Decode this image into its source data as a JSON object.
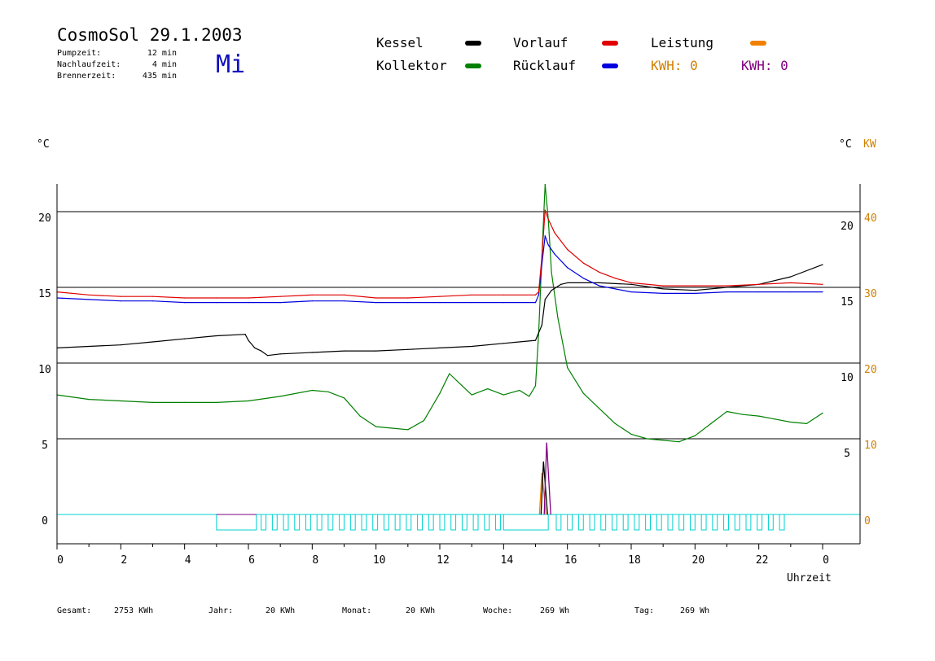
{
  "header": {
    "title": "CosmoSol 29.1.2003",
    "day": "Mi",
    "stats": [
      {
        "label": "Pumpzeit:",
        "value": "12 min"
      },
      {
        "label": "Nachlaufzeit:",
        "value": "4 min"
      },
      {
        "label": "Brennerzeit:",
        "value": "435 min"
      }
    ]
  },
  "legend": [
    {
      "label": "Kessel",
      "color": "#000000"
    },
    {
      "label": "Vorlauf",
      "color": "#e00000"
    },
    {
      "label": "Leistung",
      "color": "#f08000"
    },
    {
      "label": "Kollektor",
      "color": "#008000"
    },
    {
      "label": "Rücklauf",
      "color": "#0000e0"
    }
  ],
  "kwh": [
    {
      "text": "KWH: 0",
      "color": "#d08000"
    },
    {
      "text": "KWH: 0",
      "color": "#800080"
    }
  ],
  "axis_units": {
    "left": "°C",
    "right": "°C",
    "right_kw": "KW"
  },
  "footer": [
    {
      "label": "Gesamt:",
      "value": "2753 KWh"
    },
    {
      "label": "Jahr:",
      "value": "20 KWh"
    },
    {
      "label": "Monat:",
      "value": "20 KWh"
    },
    {
      "label": "Woche:",
      "value": "269 Wh"
    },
    {
      "label": "Tag:",
      "value": "269 Wh"
    }
  ],
  "colors": {
    "kessel": "#000000",
    "vorlauf": "#e00000",
    "ruecklauf": "#0000e0",
    "kollektor": "#008000",
    "leistung": "#f08000",
    "pump": "#00d0d0",
    "kw_axis": "#d08000",
    "purple": "#800080"
  },
  "chart_data": {
    "type": "line",
    "xlabel": "Uhrzeit",
    "xlim": [
      0,
      24
    ],
    "ylim": [
      -3,
      22
    ],
    "x_ticks": [
      0,
      2,
      4,
      6,
      8,
      10,
      12,
      14,
      16,
      18,
      20,
      22,
      24
    ],
    "x_tick_labels": [
      "0",
      "2",
      "4",
      "6",
      "8",
      "10",
      "12",
      "14",
      "16",
      "18",
      "20",
      "22",
      "0"
    ],
    "y_ticks_left": [
      0,
      5,
      10,
      15,
      20
    ],
    "y_ticks_right": [
      5,
      10,
      15,
      20
    ],
    "y_ticks_kw": [
      0,
      10,
      20,
      30,
      40
    ],
    "hlines": [
      0,
      5,
      10,
      15,
      20
    ],
    "series": [
      {
        "name": "Vorlauf",
        "color": "#e00000",
        "x": [
          0,
          1,
          2,
          3,
          4,
          5,
          6,
          7,
          8,
          9,
          10,
          11,
          12,
          13,
          14,
          15,
          15.1,
          15.2,
          15.3,
          15.4,
          15.6,
          16,
          16.5,
          17,
          17.5,
          18,
          19,
          20,
          21,
          22,
          23,
          24
        ],
        "y": [
          14.7,
          14.5,
          14.4,
          14.4,
          14.3,
          14.3,
          14.3,
          14.4,
          14.5,
          14.5,
          14.3,
          14.3,
          14.4,
          14.5,
          14.5,
          14.5,
          14.7,
          17,
          20.1,
          19.5,
          18.6,
          17.5,
          16.6,
          16,
          15.6,
          15.3,
          15.1,
          15.1,
          15.1,
          15.2,
          15.3,
          15.2
        ]
      },
      {
        "name": "Rücklauf",
        "color": "#0000e0",
        "x": [
          0,
          1,
          2,
          3,
          4,
          5,
          6,
          7,
          8,
          9,
          10,
          11,
          12,
          13,
          14,
          15,
          15.1,
          15.2,
          15.3,
          15.4,
          15.6,
          16,
          16.5,
          17,
          17.5,
          18,
          19,
          20,
          21,
          22,
          23,
          24
        ],
        "y": [
          14.3,
          14.2,
          14.1,
          14.1,
          14.0,
          14.0,
          14.0,
          14.0,
          14.1,
          14.1,
          14.0,
          14.0,
          14.0,
          14.0,
          14.0,
          14.0,
          14.5,
          16.5,
          18.4,
          17.8,
          17.2,
          16.3,
          15.6,
          15.1,
          14.9,
          14.7,
          14.6,
          14.6,
          14.7,
          14.7,
          14.7,
          14.7
        ]
      },
      {
        "name": "Kessel",
        "color": "#000000",
        "x": [
          0,
          1,
          2,
          3,
          4,
          5,
          5.9,
          6.0,
          6.2,
          6.4,
          6.6,
          7,
          8,
          9,
          10,
          11,
          12,
          13,
          14,
          15,
          15.2,
          15.3,
          15.5,
          15.8,
          16,
          17,
          18,
          19,
          20,
          21,
          22,
          23,
          24
        ],
        "y": [
          11.0,
          11.1,
          11.2,
          11.4,
          11.6,
          11.8,
          11.9,
          11.5,
          11.0,
          10.8,
          10.5,
          10.6,
          10.7,
          10.8,
          10.8,
          10.9,
          11.0,
          11.1,
          11.3,
          11.5,
          12.5,
          14.2,
          14.8,
          15.2,
          15.3,
          15.3,
          15.2,
          14.9,
          14.8,
          15.0,
          15.2,
          15.7,
          16.5
        ]
      },
      {
        "name": "Kollektor",
        "color": "#008000",
        "x": [
          0,
          1,
          2,
          3,
          4,
          5,
          6,
          7,
          8,
          8.5,
          9,
          9.5,
          10,
          10.5,
          11,
          11.5,
          12,
          12.3,
          12.7,
          13,
          13.5,
          14,
          14.5,
          14.8,
          15,
          15.1,
          15.2,
          15.3,
          15.4,
          15.5,
          15.7,
          16,
          16.5,
          17,
          17.5,
          18,
          18.5,
          19,
          19.5,
          20,
          20.5,
          21,
          21.5,
          22,
          22.5,
          23,
          23.5,
          24
        ],
        "y": [
          7.9,
          7.6,
          7.5,
          7.4,
          7.4,
          7.4,
          7.5,
          7.8,
          8.2,
          8.1,
          7.7,
          6.5,
          5.8,
          5.7,
          5.6,
          6.2,
          8.0,
          9.3,
          8.5,
          7.9,
          8.3,
          7.9,
          8.2,
          7.8,
          8.5,
          12,
          17,
          21.8,
          19.5,
          16,
          13,
          9.7,
          8.0,
          7.0,
          6.0,
          5.3,
          5.0,
          4.9,
          4.8,
          5.2,
          6.0,
          6.8,
          6.6,
          6.5,
          6.3,
          6.1,
          6.0,
          6.7
        ]
      }
    ],
    "leistung_spikes": [
      {
        "x": 15.2,
        "kw": 5.5,
        "color": "#f08000"
      },
      {
        "x": 15.25,
        "kw": 7.0,
        "color": "#000000"
      },
      {
        "x": 15.35,
        "kw": 9.5,
        "color": "#800080"
      }
    ],
    "pump_blocks": [
      [
        5.0,
        6.25
      ],
      [
        6.4,
        6.55
      ],
      [
        6.75,
        6.9
      ],
      [
        7.1,
        7.25
      ],
      [
        7.45,
        7.6
      ],
      [
        7.8,
        7.95
      ],
      [
        8.15,
        8.3
      ],
      [
        8.5,
        8.65
      ],
      [
        8.85,
        9.0
      ],
      [
        9.2,
        9.35
      ],
      [
        9.55,
        9.7
      ],
      [
        9.9,
        10.05
      ],
      [
        10.25,
        10.4
      ],
      [
        10.6,
        10.75
      ],
      [
        10.95,
        11.1
      ],
      [
        11.3,
        11.45
      ],
      [
        11.65,
        11.8
      ],
      [
        12.0,
        12.15
      ],
      [
        12.35,
        12.5
      ],
      [
        12.7,
        12.85
      ],
      [
        13.05,
        13.2
      ],
      [
        13.4,
        13.55
      ],
      [
        13.75,
        13.9
      ],
      [
        14.0,
        15.4
      ],
      [
        15.65,
        15.8
      ],
      [
        16.0,
        16.15
      ],
      [
        16.35,
        16.5
      ],
      [
        16.7,
        16.85
      ],
      [
        17.05,
        17.2
      ],
      [
        17.4,
        17.55
      ],
      [
        17.75,
        17.9
      ],
      [
        18.1,
        18.25
      ],
      [
        18.45,
        18.6
      ],
      [
        18.8,
        18.95
      ],
      [
        19.15,
        19.3
      ],
      [
        19.5,
        19.65
      ],
      [
        19.85,
        20.0
      ],
      [
        20.2,
        20.35
      ],
      [
        20.55,
        20.7
      ],
      [
        20.9,
        21.05
      ],
      [
        21.25,
        21.4
      ],
      [
        21.6,
        21.75
      ],
      [
        21.95,
        22.1
      ],
      [
        22.3,
        22.45
      ],
      [
        22.65,
        22.8
      ]
    ]
  }
}
